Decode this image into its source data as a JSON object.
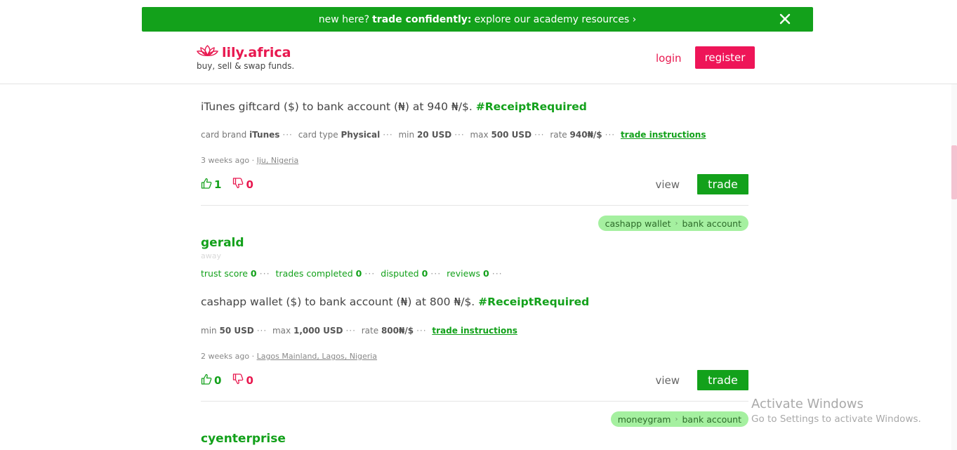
{
  "banner": {
    "pre": "new here?",
    "bold": "trade confidently:",
    "post": "explore our academy resources ›"
  },
  "header": {
    "logo_text": "lily.africa",
    "tagline": "buy, sell & swap funds.",
    "login_label": "login",
    "register_label": "register"
  },
  "listings": [
    {
      "title": "iTunes giftcard ($) to bank account (₦) at 940 ₦/$.",
      "hashtag": "#ReceiptRequired",
      "details": [
        {
          "label": "card brand",
          "value": "iTunes"
        },
        {
          "label": "card type",
          "value": "Physical"
        },
        {
          "label": "min",
          "value": "20 USD"
        },
        {
          "label": "max",
          "value": "500 USD"
        },
        {
          "label": "rate",
          "value": "940₦/$"
        }
      ],
      "instructions_label": "trade instructions",
      "time": "3 weeks ago",
      "location": "Iju, Nigeria",
      "likes": "1",
      "dislikes": "0",
      "view_label": "view",
      "trade_label": "trade"
    },
    {
      "pill_from": "cashapp wallet",
      "pill_to": "bank account",
      "user": "gerald",
      "status": "away",
      "stats": [
        {
          "label": "trust score",
          "value": "0"
        },
        {
          "label": "trades completed",
          "value": "0"
        },
        {
          "label": "disputed",
          "value": "0"
        },
        {
          "label": "reviews",
          "value": "0"
        }
      ],
      "title": "cashapp wallet ($) to bank account (₦) at 800 ₦/$.",
      "hashtag": "#ReceiptRequired",
      "details": [
        {
          "label": "min",
          "value": "50 USD"
        },
        {
          "label": "max",
          "value": "1,000 USD"
        },
        {
          "label": "rate",
          "value": "800₦/$"
        }
      ],
      "instructions_label": "trade instructions",
      "time": "2 weeks ago",
      "location": "Lagos Mainland, Lagos, Nigeria",
      "likes": "0",
      "dislikes": "0",
      "view_label": "view",
      "trade_label": "trade"
    },
    {
      "pill_from": "moneygram",
      "pill_to": "bank account",
      "user": "cyenterprise"
    }
  ],
  "watermark": {
    "line1": "Activate Windows",
    "line2": "Go to Settings to activate Windows."
  }
}
